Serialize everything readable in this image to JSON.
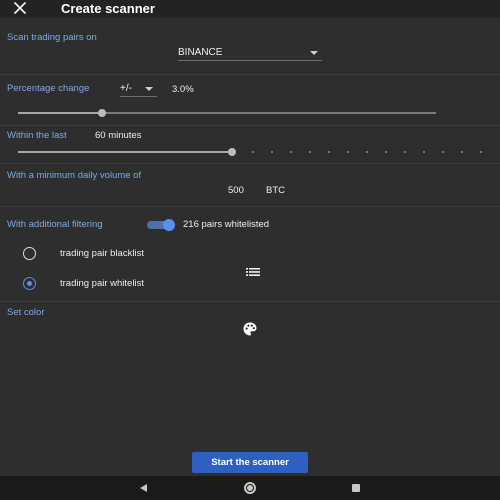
{
  "header": {
    "title": "Create scanner",
    "close_icon": "close-icon"
  },
  "exchange": {
    "label": "Scan trading pairs on",
    "value": "BINANCE"
  },
  "percentage": {
    "label": "Percentage change",
    "operator": "+/-",
    "value_text": "3.0%",
    "slider_level": 0.2
  },
  "timeframe": {
    "label": "Within the last",
    "value_text": "60 minutes",
    "slider_level": 0.46
  },
  "volume": {
    "label": "With a minimum daily volume of",
    "amount": "500",
    "unit": "BTC"
  },
  "filtering": {
    "label": "With additional filtering",
    "enabled": true,
    "status_text": "216 pairs whitelisted",
    "options": [
      {
        "label": "trading pair blacklist",
        "selected": false
      },
      {
        "label": "trading pair whitelist",
        "selected": true
      }
    ],
    "list_icon": "list-icon"
  },
  "color": {
    "label": "Set color",
    "icon": "palette-icon"
  },
  "actions": {
    "start_label": "Start the scanner"
  },
  "colors": {
    "background": "#2e2e2e",
    "accent": "#5a8ef0",
    "section_label": "#7fa8e6",
    "button": "#2f5fc0"
  }
}
